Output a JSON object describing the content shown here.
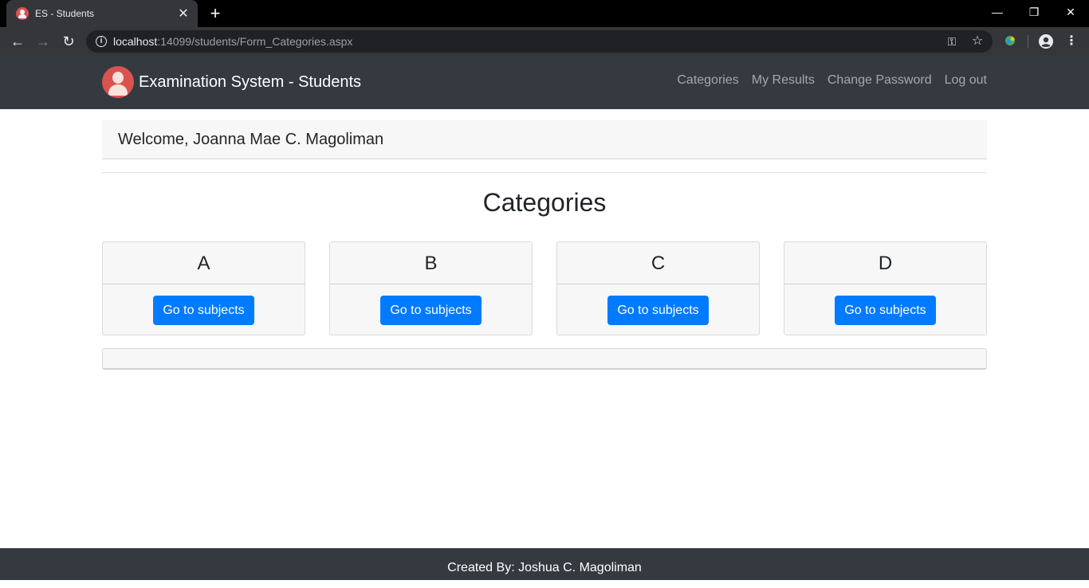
{
  "browser": {
    "tab_title": "ES - Students",
    "url_host": "localhost",
    "url_path": ":14099/students/Form_Categories.aspx",
    "icons": {
      "back": "arrow-back-icon",
      "forward": "arrow-forward-icon",
      "reload": "reload-icon",
      "info": "info-icon",
      "key": "key-icon",
      "star": "star-icon",
      "extension": "extension-icon",
      "profile": "profile-icon",
      "menu": "menu-icon"
    }
  },
  "navbar": {
    "brand": "Examination System - Students",
    "links": {
      "categories": "Categories",
      "my_results": "My Results",
      "change_password": "Change Password",
      "logout": "Log out"
    }
  },
  "welcome": "Welcome, Joanna Mae C. Magoliman",
  "heading": "Categories",
  "categories": [
    {
      "name": "A",
      "button": "Go to subjects"
    },
    {
      "name": "B",
      "button": "Go to subjects"
    },
    {
      "name": "C",
      "button": "Go to subjects"
    },
    {
      "name": "D",
      "button": "Go to subjects"
    }
  ],
  "footer": "Created By: Joshua C. Magoliman",
  "colors": {
    "navbar": "#343a40",
    "primary_button": "#007bff",
    "card_bg": "#f7f7f7"
  }
}
